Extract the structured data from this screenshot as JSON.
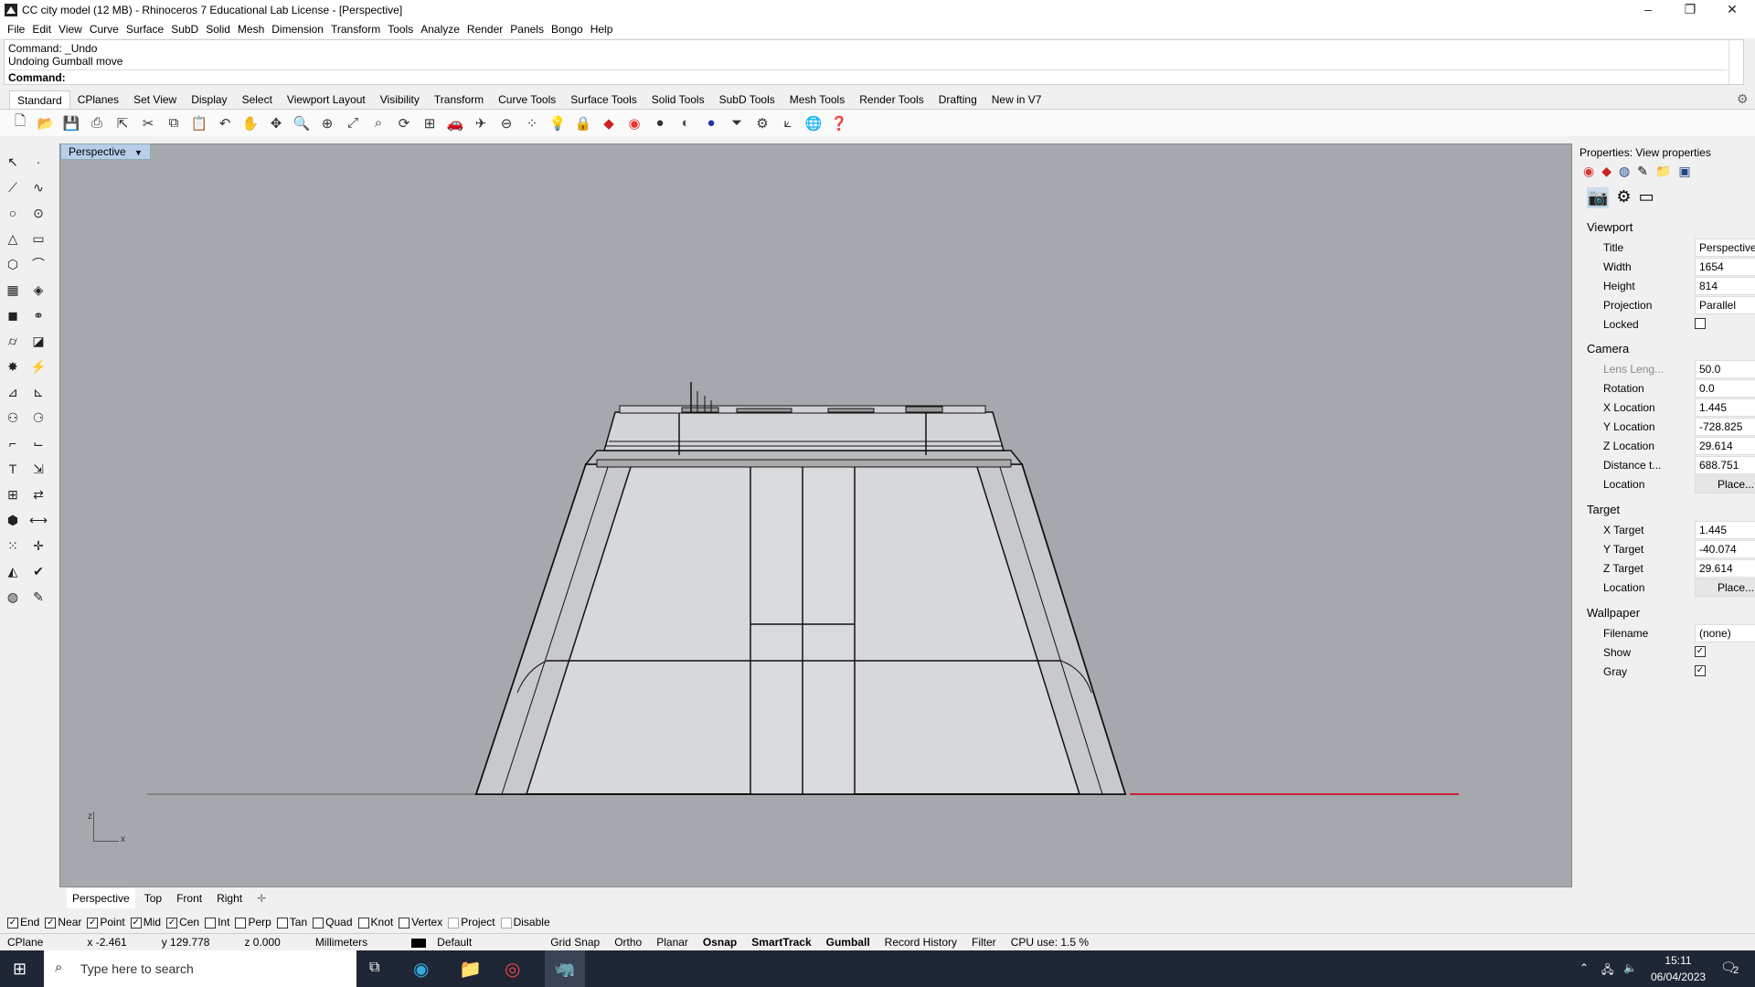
{
  "title": "CC city model (12 MB) - Rhinoceros 7 Educational Lab License - [Perspective]",
  "menu": [
    "File",
    "Edit",
    "View",
    "Curve",
    "Surface",
    "SubD",
    "Solid",
    "Mesh",
    "Dimension",
    "Transform",
    "Tools",
    "Analyze",
    "Render",
    "Panels",
    "Bongo",
    "Help"
  ],
  "command": {
    "line1": "Command: _Undo",
    "line2": "Undoing Gumball move",
    "prompt": "Command:"
  },
  "tabs": [
    "Standard",
    "CPlanes",
    "Set View",
    "Display",
    "Select",
    "Viewport Layout",
    "Visibility",
    "Transform",
    "Curve Tools",
    "Surface Tools",
    "Solid Tools",
    "SubD Tools",
    "Mesh Tools",
    "Render Tools",
    "Drafting",
    "New in V7"
  ],
  "viewport_title": "Perspective",
  "view_tabs": [
    "Perspective",
    "Top",
    "Front",
    "Right"
  ],
  "osnap": [
    {
      "label": "End",
      "checked": true
    },
    {
      "label": "Near",
      "checked": true
    },
    {
      "label": "Point",
      "checked": true
    },
    {
      "label": "Mid",
      "checked": true
    },
    {
      "label": "Cen",
      "checked": true
    },
    {
      "label": "Int",
      "checked": false
    },
    {
      "label": "Perp",
      "checked": false
    },
    {
      "label": "Tan",
      "checked": false
    },
    {
      "label": "Quad",
      "checked": false
    },
    {
      "label": "Knot",
      "checked": false
    },
    {
      "label": "Vertex",
      "checked": false
    },
    {
      "label": "Project",
      "checked": false
    },
    {
      "label": "Disable",
      "checked": false
    }
  ],
  "status": {
    "cplane": "CPlane",
    "x": "x -2.461",
    "y": "y 129.778",
    "z": "z 0.000",
    "units": "Millimeters",
    "layer": "Default",
    "grid_snap": "Grid Snap",
    "ortho": "Ortho",
    "planar": "Planar",
    "osnap": "Osnap",
    "smarttrack": "SmartTrack",
    "gumball": "Gumball",
    "record": "Record History",
    "filter": "Filter",
    "cpu": "CPU use: 1.5 %"
  },
  "props": {
    "header": "Properties: View properties",
    "viewport_section": "Viewport",
    "title_label": "Title",
    "title": "Perspective",
    "width_label": "Width",
    "width": "1654",
    "height_label": "Height",
    "height": "814",
    "projection_label": "Projection",
    "projection": "Parallel",
    "locked_label": "Locked",
    "camera_section": "Camera",
    "lens_label": "Lens Leng...",
    "lens": "50.0",
    "rotation_label": "Rotation",
    "rotation": "0.0",
    "xloc_label": "X Location",
    "xloc": "1.445",
    "yloc_label": "Y Location",
    "yloc": "-728.825",
    "zloc_label": "Z Location",
    "zloc": "29.614",
    "dist_label": "Distance t...",
    "dist": "688.751",
    "loc_label": "Location",
    "place": "Place...",
    "target_section": "Target",
    "xt_label": "X Target",
    "xt": "1.445",
    "yt_label": "Y Target",
    "yt": "-40.074",
    "zt_label": "Z Target",
    "zt": "29.614",
    "tloc_label": "Location",
    "tplace": "Place...",
    "wallpaper_section": "Wallpaper",
    "fn_label": "Filename",
    "fn": "(none)",
    "show_label": "Show",
    "gray_label": "Gray"
  },
  "taskbar": {
    "search": "Type here to search",
    "time": "15:11",
    "date": "06/04/2023",
    "notif": "2"
  },
  "axis": {
    "z": "z",
    "x": "x"
  }
}
